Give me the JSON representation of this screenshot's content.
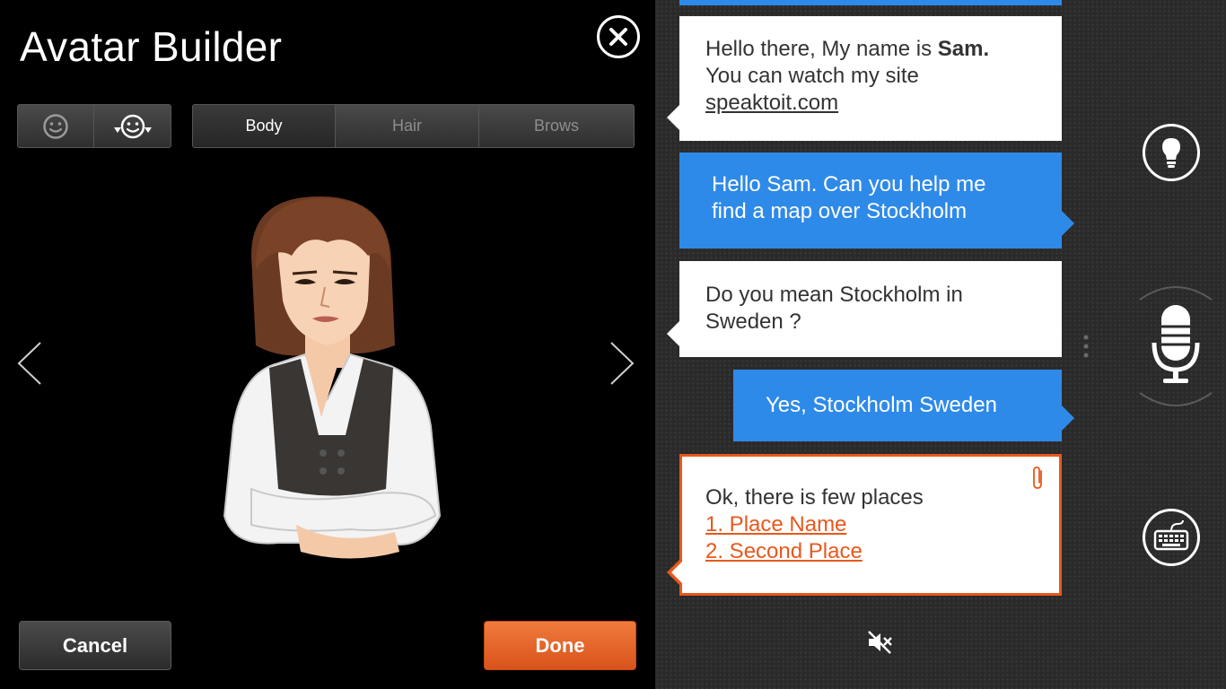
{
  "header": {
    "title": "Avatar Builder"
  },
  "tabs": [
    {
      "label": "Body",
      "active": true
    },
    {
      "label": "Hair",
      "active": false
    },
    {
      "label": "Brows",
      "active": false
    }
  ],
  "face_options": [
    {
      "icon": "smiley-face-icon"
    },
    {
      "icon": "face-dropdown-icon"
    }
  ],
  "footer": {
    "cancel_label": "Cancel",
    "done_label": "Done"
  },
  "chat": {
    "messages": [
      {
        "from": "assistant",
        "line1": "Hello there, My name is ",
        "name": "Sam.",
        "line2": "You can watch my site",
        "link": "speaktoit.com"
      },
      {
        "from": "user",
        "line1": "Hello Sam. Can you help me",
        "line2": "find a map over Stockholm"
      },
      {
        "from": "assistant",
        "line1": "Do you mean Stockholm in",
        "line2": "Sweden ?"
      },
      {
        "from": "user",
        "text": "Yes, Stockholm Sweden"
      },
      {
        "from": "assistant",
        "text": "Ok, there is few places",
        "links": [
          "1. Place Name",
          "2. Second Place"
        ]
      }
    ]
  },
  "colors": {
    "accent_blue": "#2e8ae8",
    "accent_orange": "#e8581c"
  },
  "icons": [
    "close-icon",
    "lightbulb-icon",
    "microphone-icon",
    "keyboard-icon",
    "mute-icon",
    "paperclip-icon",
    "chevron-left-icon",
    "chevron-right-icon"
  ]
}
